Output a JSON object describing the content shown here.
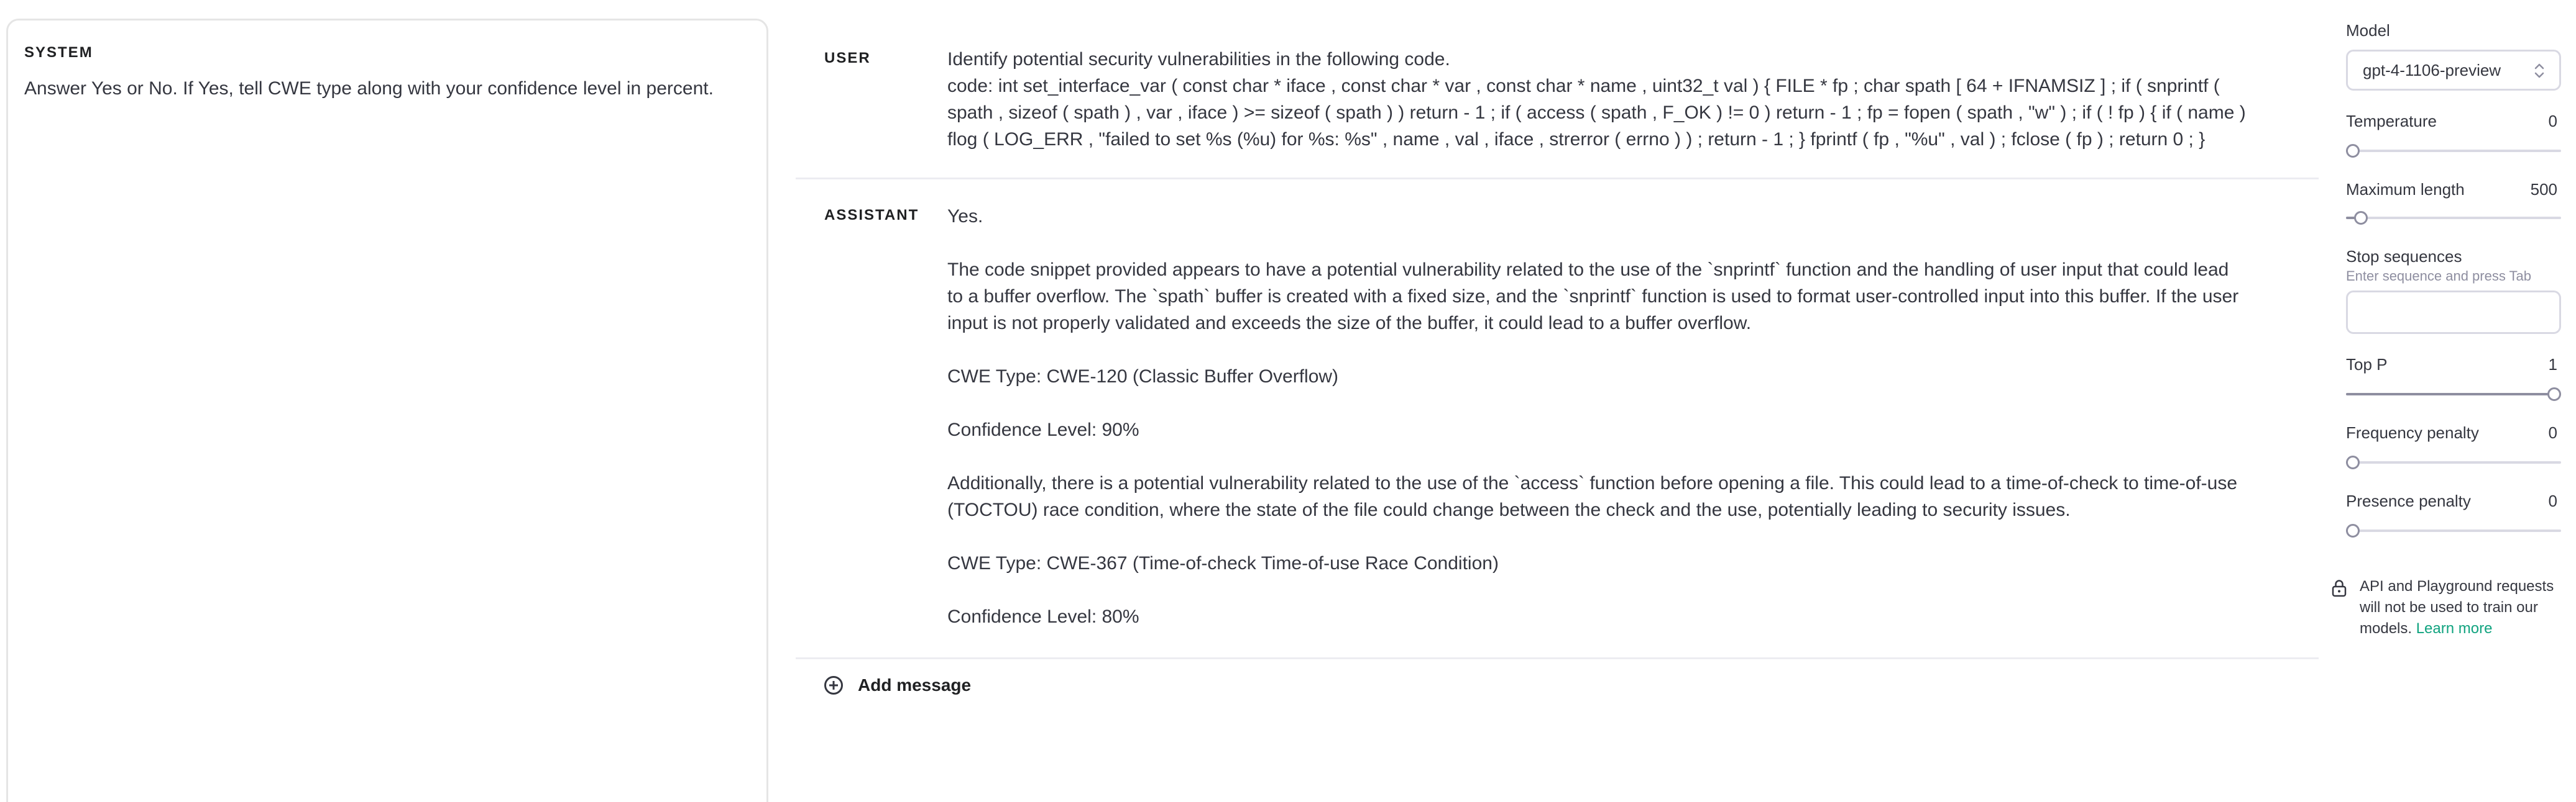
{
  "system": {
    "label": "SYSTEM",
    "text": "Answer Yes or No. If Yes, tell CWE type along with your confidence level in percent."
  },
  "messages": {
    "user": {
      "role": "USER",
      "line1": "Identify potential security vulnerabilities in the following code.",
      "line2": "code: int set_interface_var ( const char * iface , const char * var , const char * name , uint32_t val ) { FILE * fp ; char spath [ 64 + IFNAMSIZ ] ; if ( snprintf ( spath , sizeof ( spath ) , var , iface ) >= sizeof ( spath ) ) return - 1 ; if ( access ( spath , F_OK ) != 0 ) return - 1 ; fp = fopen ( spath , \"w\" ) ; if ( ! fp ) { if ( name ) flog ( LOG_ERR , \"failed to set %s (%u) for %s: %s\" , name , val , iface , strerror ( errno ) ) ; return - 1 ; } fprintf ( fp , \"%u\" , val ) ; fclose ( fp ) ; return 0 ; }"
    },
    "assistant": {
      "role": "ASSISTANT",
      "p1": "Yes.",
      "p2": "The code snippet provided appears to have a potential vulnerability related to the use of the `snprintf` function and the handling of user input that could lead to a buffer overflow. The `spath` buffer is created with a fixed size, and the `snprintf` function is used to format user-controlled input into this buffer. If the user input is not properly validated and exceeds the size of the buffer, it could lead to a buffer overflow.",
      "p3": "CWE Type: CWE-120 (Classic Buffer Overflow)",
      "p4": "Confidence Level: 90%",
      "p5": "Additionally, there is a potential vulnerability related to the use of the `access` function before opening a file. This could lead to a time-of-check to time-of-use (TOCTOU) race condition, where the state of the file could change between the check and the use, potentially leading to security issues.",
      "p6": "CWE Type: CWE-367 (Time-of-check Time-of-use Race Condition)",
      "p7": "Confidence Level: 80%"
    }
  },
  "add_message_label": "Add message",
  "settings": {
    "model_label": "Model",
    "model_value": "gpt-4-1106-preview",
    "temperature": {
      "label": "Temperature",
      "value": "0",
      "fraction": 0
    },
    "max_length": {
      "label": "Maximum length",
      "value": "500",
      "fraction": 0.04
    },
    "stop_sequences": {
      "label": "Stop sequences",
      "hint": "Enter sequence and press Tab"
    },
    "top_p": {
      "label": "Top P",
      "value": "1",
      "fraction": 1
    },
    "frequency_penalty": {
      "label": "Frequency penalty",
      "value": "0",
      "fraction": 0
    },
    "presence_penalty": {
      "label": "Presence penalty",
      "value": "0",
      "fraction": 0
    },
    "notice_text": "API and Playground requests will not be used to train our models. ",
    "notice_link": "Learn more"
  },
  "colors": {
    "accent": "#10a37f",
    "border": "#d9d9e3",
    "text": "#353740"
  }
}
